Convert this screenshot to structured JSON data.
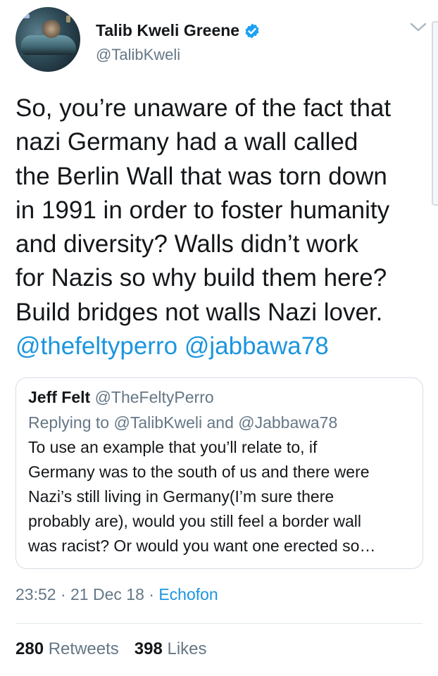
{
  "author": {
    "display_name": "Talib Kweli Greene",
    "handle": "@TalibKweli",
    "verified_icon": "verified-badge-icon",
    "accent_color": "#1da1f2"
  },
  "tweet": {
    "text_lines": [
      "So, you’re unaware of the fact that",
      "nazi Germany had a wall called",
      "the Berlin Wall that was torn down",
      "in 1991 in order to foster humanity",
      "and diversity? Walls didn’t work",
      "for Nazis so why build them here?",
      "Build bridges not walls Nazi lover."
    ],
    "mentions": [
      "@thefeltyperro",
      "@jabbawa78"
    ],
    "mention_color": "#1b95e0"
  },
  "quoted_tweet": {
    "name": "Jeff Felt",
    "handle": "@TheFeltyPerro",
    "replying_prefix": "Replying to",
    "replying_to_1": "@TalibKweli",
    "replying_and": "and",
    "replying_to_2": "@Jabbawa78",
    "text_lines": [
      "To use an example that you’ll relate to, if",
      "Germany was to the south of us and there were",
      "Nazi’s still living in Germany(I’m sure there",
      "probably are), would you still feel a border wall",
      "was racist? Or would you want one erected so…"
    ]
  },
  "meta": {
    "time": "23:52",
    "date": "21 Dec 18",
    "source": "Echofon"
  },
  "stats": {
    "retweets_count": "280",
    "retweets_label": "Retweets",
    "likes_count": "398",
    "likes_label": "Likes"
  }
}
